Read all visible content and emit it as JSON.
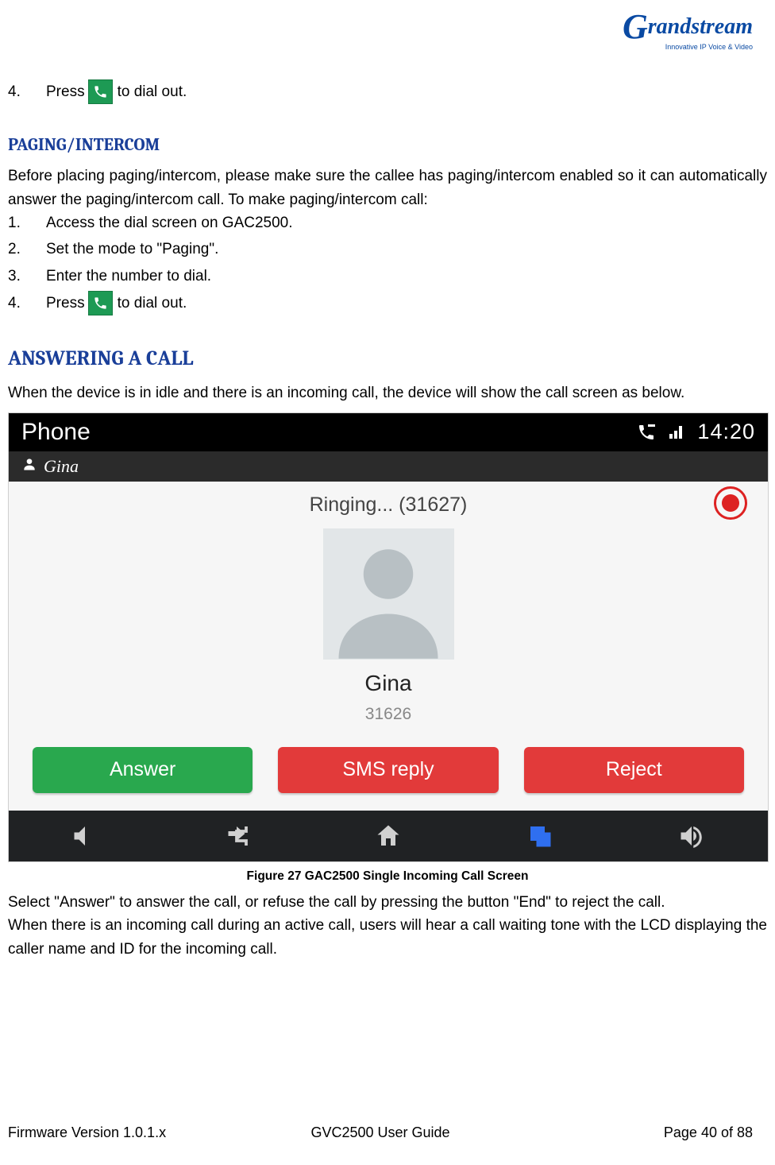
{
  "logo": {
    "word": "Grandstream",
    "tag": "Innovative IP Voice & Video"
  },
  "step4": {
    "num": "4.",
    "pre": "Press",
    "post": " to dial out."
  },
  "sec_paging": {
    "heading": "PAGING/INTERCOM",
    "intro": "Before placing paging/intercom, please make sure the callee has paging/intercom enabled so it can automatically answer the paging/intercom call. To make paging/intercom call:",
    "steps": [
      {
        "num": "1.",
        "text": "Access the dial screen on GAC2500."
      },
      {
        "num": "2.",
        "text": "Set the mode to \"Paging\"."
      },
      {
        "num": "3.",
        "text": "Enter the number to dial."
      }
    ],
    "step4": {
      "num": "4.",
      "pre": "Press",
      "post": " to dial out."
    }
  },
  "sec_answer": {
    "heading": "ANSWERING A CALL",
    "intro": "When the device is in idle and there is an incoming call, the device will show the call screen as below.",
    "caption": "Figure 27 GAC2500 Single Incoming Call Screen",
    "p1": "Select \"Answer\" to answer the call, or refuse the call by pressing the button \"End\" to reject the call.",
    "p2": "When there is an incoming call during an active call, users will hear a call waiting tone with the LCD displaying the caller name and ID for the incoming call."
  },
  "shot": {
    "title": "Phone",
    "time": "14:20",
    "account": "Gina",
    "ringing": "Ringing... (31627)",
    "caller_name": "Gina",
    "caller_number": "31626",
    "btn_answer": "Answer",
    "btn_sms": "SMS reply",
    "btn_reject": "Reject"
  },
  "footer": {
    "left": "Firmware Version 1.0.1.x",
    "center": "GVC2500 User Guide",
    "right": "Page 40 of 88"
  }
}
